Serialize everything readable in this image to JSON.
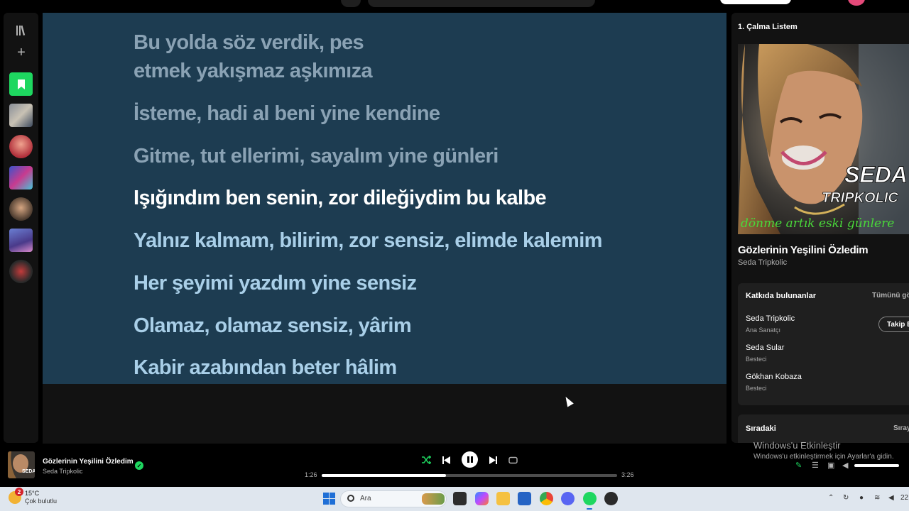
{
  "lyrics": {
    "lines": [
      "Bu yolda söz verdik, pes",
      "etmek yakışmaz aşkımıza",
      "İsteme, hadi al beni yine kendine",
      "Gitme, tut ellerimi, sayalım yine günleri",
      "Işığındım ben senin, zor dileğiydim bu kalbe",
      "Yalnız kalmam, bilirim, zor sensiz, elimde kalemim",
      "Her şeyimi yazdım yine sensiz",
      "Olamaz, olamaz sensiz, yârim",
      "Kabir azabından beter hâlim"
    ],
    "active_index": 4,
    "background": "#1d3c51"
  },
  "right_panel": {
    "playlist_title": "1. Çalma Listem",
    "cover_text_artist": "SEDA",
    "cover_text_name": "TRIPKOLIC",
    "cover_text_script": "dönme artık eski günlere",
    "song_title": "Gözlerinin Yeşilini Özledim",
    "song_artist": "Seda Tripkolic",
    "credits": {
      "header": "Katkıda bulunanlar",
      "show_all": "Tümünü gös",
      "follow_label": "Takip E",
      "people": [
        {
          "name": "Seda Tripkolic",
          "role": "Ana Sanatçı"
        },
        {
          "name": "Seda Sular",
          "role": "Besteci"
        },
        {
          "name": "Gökhan Kobaza",
          "role": "Besteci"
        }
      ]
    },
    "queue": {
      "header": "Sıradaki",
      "more": "Sıray"
    }
  },
  "player": {
    "title": "Gözlerinin Yeşilini Özledim",
    "artist": "Seda Tripkolic",
    "elapsed": "1:26",
    "duration": "3:26",
    "progress_fraction": 0.42,
    "volume_fraction": 0.95,
    "accent": "#1ed760"
  },
  "watermark": {
    "line1": "Windows'u Etkinleştir",
    "line2": "Windows'u etkinleştirmek için Ayarlar'a gidin."
  },
  "taskbar": {
    "weather_temp": "15°C",
    "weather_cond": "Çok bulutlu",
    "weather_badge": "2",
    "search_placeholder": "Ara",
    "clock_partial": "22"
  }
}
